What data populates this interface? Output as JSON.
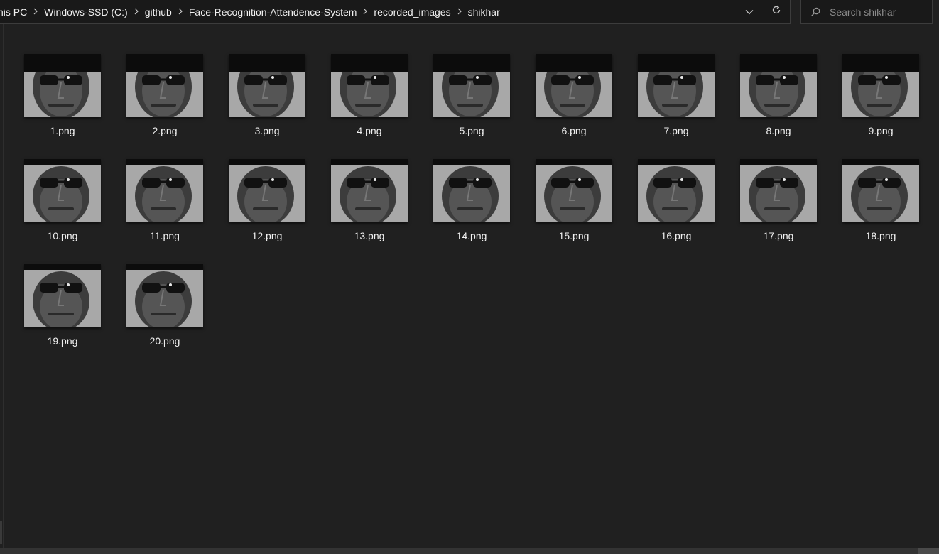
{
  "breadcrumb": [
    {
      "label": "his PC"
    },
    {
      "label": "Windows-SSD (C:)"
    },
    {
      "label": "github"
    },
    {
      "label": "Face-Recognition-Attendence-System"
    },
    {
      "label": "recorded_images"
    },
    {
      "label": "shikhar"
    }
  ],
  "address_tools": {
    "history_icon": "chevron-down-icon",
    "refresh_icon": "refresh-icon"
  },
  "search": {
    "placeholder": "Search shikhar",
    "value": "",
    "icon": "search-icon"
  },
  "files": [
    {
      "name": "1.png"
    },
    {
      "name": "2.png"
    },
    {
      "name": "3.png"
    },
    {
      "name": "4.png"
    },
    {
      "name": "5.png"
    },
    {
      "name": "6.png"
    },
    {
      "name": "7.png"
    },
    {
      "name": "8.png"
    },
    {
      "name": "9.png"
    },
    {
      "name": "10.png"
    },
    {
      "name": "11.png"
    },
    {
      "name": "12.png"
    },
    {
      "name": "13.png"
    },
    {
      "name": "14.png"
    },
    {
      "name": "15.png"
    },
    {
      "name": "16.png"
    },
    {
      "name": "17.png"
    },
    {
      "name": "18.png"
    },
    {
      "name": "19.png"
    },
    {
      "name": "20.png"
    }
  ],
  "colors": {
    "background": "#202020",
    "address_bar": "#191919",
    "text": "#f0f0f0",
    "placeholder": "#8a8a8a",
    "border": "#3c3c3c"
  }
}
